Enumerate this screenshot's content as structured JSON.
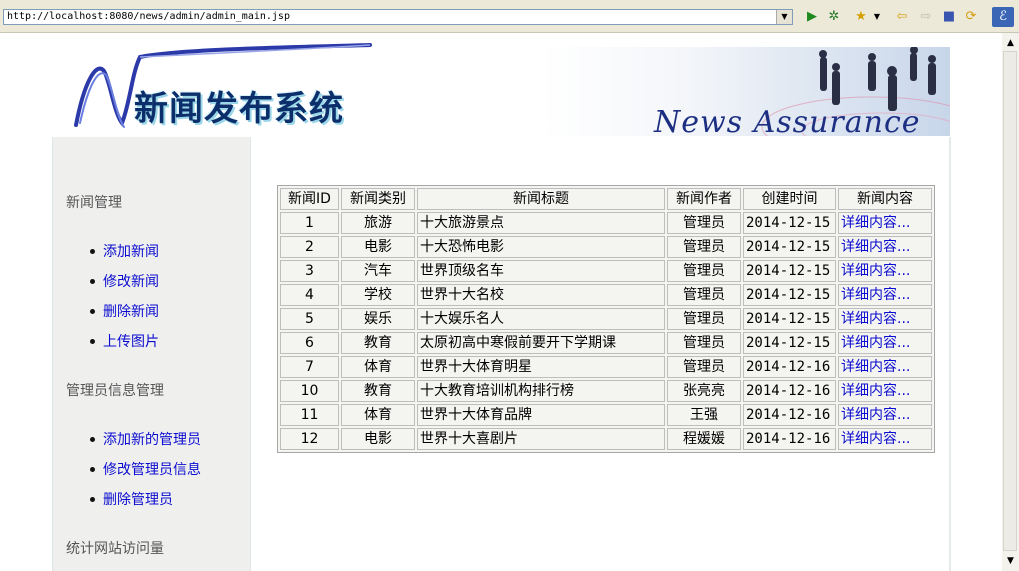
{
  "browser": {
    "url": "http://localhost:8080/news/admin/admin_main.jsp"
  },
  "header": {
    "logo_text": "新闻发布系统",
    "banner_text": "News Assurance"
  },
  "sidebar": {
    "sections": [
      {
        "title": "新闻管理",
        "links": [
          "添加新闻",
          "修改新闻",
          "删除新闻",
          "上传图片"
        ]
      },
      {
        "title": "管理员信息管理",
        "links": [
          "添加新的管理员",
          "修改管理员信息",
          "删除管理员"
        ]
      },
      {
        "title": "统计网站访问量",
        "links": []
      }
    ]
  },
  "table": {
    "headers": [
      "新闻ID",
      "新闻类别",
      "新闻标题",
      "新闻作者",
      "创建时间",
      "新闻内容"
    ],
    "rows": [
      {
        "id": "1",
        "category": "旅游",
        "title": "十大旅游景点",
        "author": "管理员",
        "time": "2014-12-15",
        "detail": "详细内容..."
      },
      {
        "id": "2",
        "category": "电影",
        "title": "十大恐怖电影",
        "author": "管理员",
        "time": "2014-12-15",
        "detail": "详细内容..."
      },
      {
        "id": "3",
        "category": "汽车",
        "title": "世界顶级名车",
        "author": "管理员",
        "time": "2014-12-15",
        "detail": "详细内容..."
      },
      {
        "id": "4",
        "category": "学校",
        "title": "世界十大名校",
        "author": "管理员",
        "time": "2014-12-15",
        "detail": "详细内容..."
      },
      {
        "id": "5",
        "category": "娱乐",
        "title": "十大娱乐名人",
        "author": "管理员",
        "time": "2014-12-15",
        "detail": "详细内容..."
      },
      {
        "id": "6",
        "category": "教育",
        "title": "太原初高中寒假前要开下学期课",
        "author": "管理员",
        "time": "2014-12-15",
        "detail": "详细内容..."
      },
      {
        "id": "7",
        "category": "体育",
        "title": "世界十大体育明星",
        "author": "管理员",
        "time": "2014-12-16",
        "detail": "详细内容..."
      },
      {
        "id": "10",
        "category": "教育",
        "title": "十大教育培训机构排行榜",
        "author": "张亮亮",
        "time": "2014-12-16",
        "detail": "详细内容..."
      },
      {
        "id": "11",
        "category": "体育",
        "title": "世界十大体育品牌",
        "author": "王强",
        "time": "2014-12-16",
        "detail": "详细内容..."
      },
      {
        "id": "12",
        "category": "电影",
        "title": "世界十大喜剧片",
        "author": "程媛媛",
        "time": "2014-12-16",
        "detail": "详细内容..."
      }
    ]
  },
  "colors": {
    "link": "#0b0bd0",
    "sidebar_bg": "#eff0ee",
    "logo_text": "#0c2f6b",
    "banner_text": "#1d2f82"
  }
}
